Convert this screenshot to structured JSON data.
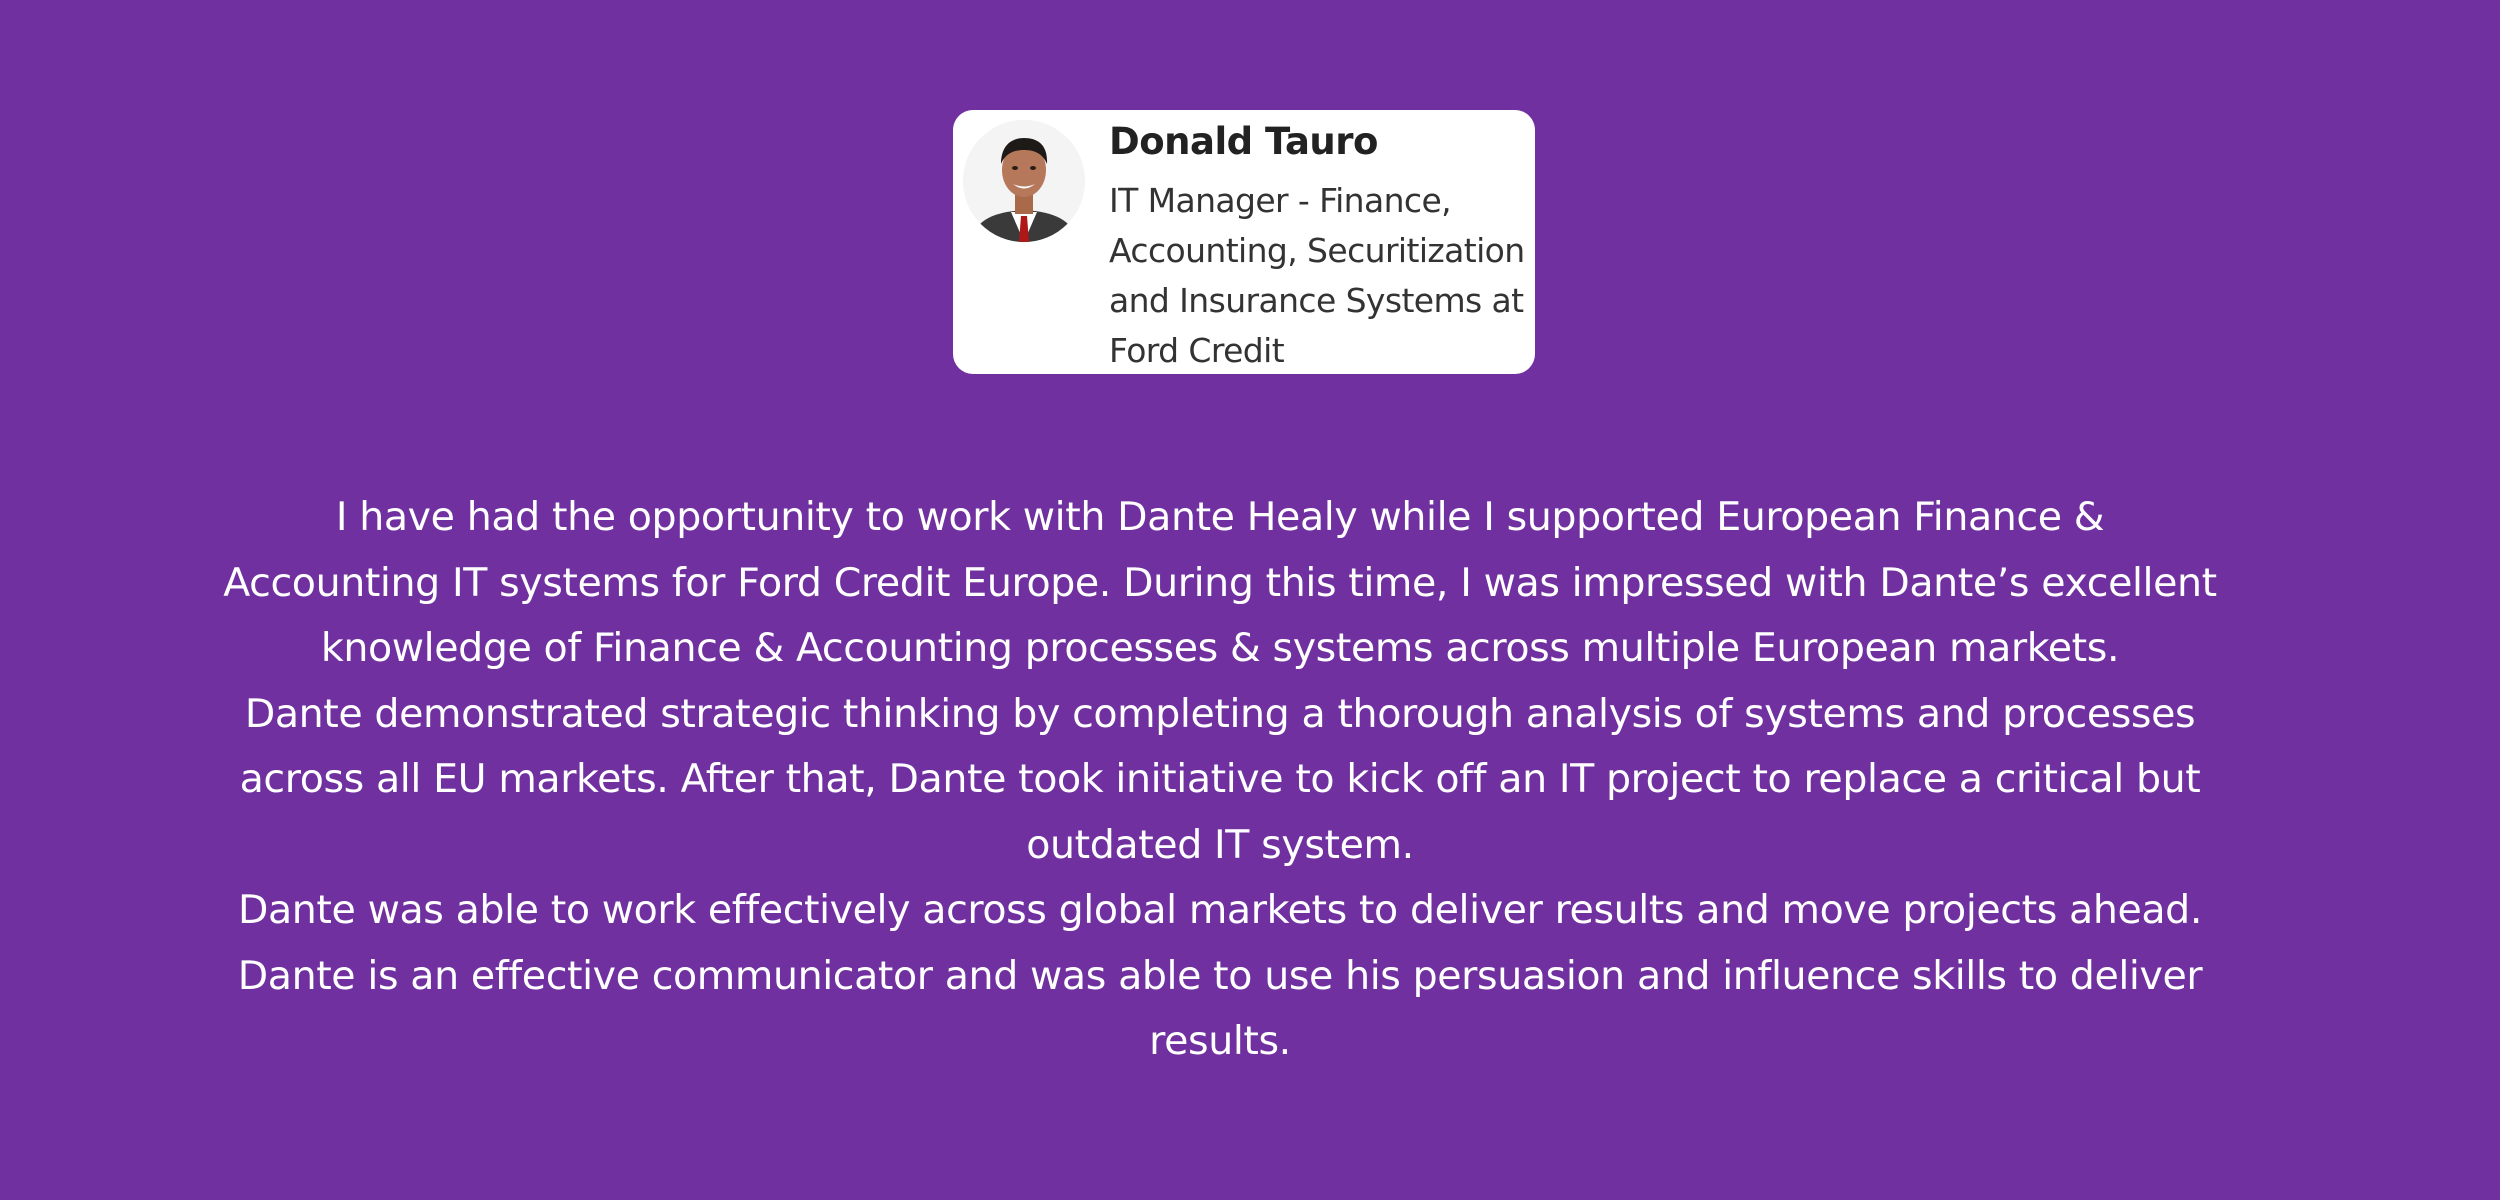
{
  "colors": {
    "background": "#7030a0",
    "card_background": "#ffffff",
    "text_on_background": "#ffffff",
    "card_name": "#222222",
    "card_headline": "#333333"
  },
  "profile": {
    "name": "Donald Tauro",
    "headline": "IT Manager - Finance, Accounting, Securitization and Insurance Systems at Ford Credit",
    "photo_icon": "person-portrait"
  },
  "testimonial": {
    "lines": [
      "I have had the opportunity to work with Dante Healy while I supported European Finance &",
      "Accounting IT systems for Ford Credit Europe. During this time, I was impressed with Dante’s excellent",
      "knowledge of Finance & Accounting processes & systems across multiple European markets.",
      "Dante demonstrated strategic thinking by completing a thorough analysis of systems and processes",
      "across all EU markets. After that, Dante took initiative to kick off an IT project to replace a critical but",
      "outdated IT system.",
      "Dante was able to work effectively across global markets to deliver results and move projects ahead.",
      "Dante is an effective communicator and was able to use his persuasion and influence skills to deliver",
      "results."
    ]
  }
}
